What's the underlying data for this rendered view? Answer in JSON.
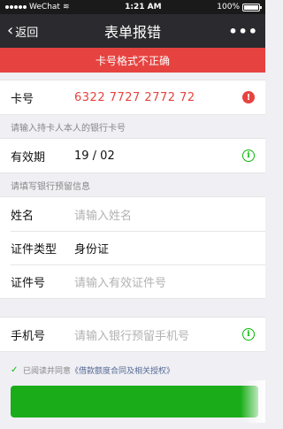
{
  "status_bar": {
    "carrier": "WeChat",
    "time": "1:21 AM",
    "battery": "100%",
    "battery_level": 1.0
  },
  "nav": {
    "back_label": "返回",
    "title": "表单报错",
    "more": "•••"
  },
  "error_banner": "卡号格式不正确",
  "card": {
    "label": "卡号",
    "value": "6322 7727 2772 72"
  },
  "tip_cardholder": "请输入持卡人本人的银行卡号",
  "expiry": {
    "label": "有效期",
    "value": "19 / 02"
  },
  "tip_reserved": "请填写银行预留信息",
  "name": {
    "label": "姓名",
    "placeholder": "请输入姓名"
  },
  "id_type": {
    "label": "证件类型",
    "value": "身份证"
  },
  "id_number": {
    "label": "证件号",
    "placeholder": "请输入有效证件号"
  },
  "phone": {
    "label": "手机号",
    "placeholder": "请输入银行预留手机号"
  },
  "agreement": {
    "text": "已阅读并同意",
    "link": "《借款额度合同及相关授权》"
  },
  "icons": {
    "warn": "!",
    "info": "i",
    "check": "✓"
  },
  "colors": {
    "error": "#e64340",
    "primary": "#1aad19",
    "nav_bg": "#2b2b2f",
    "link": "#576b95"
  }
}
